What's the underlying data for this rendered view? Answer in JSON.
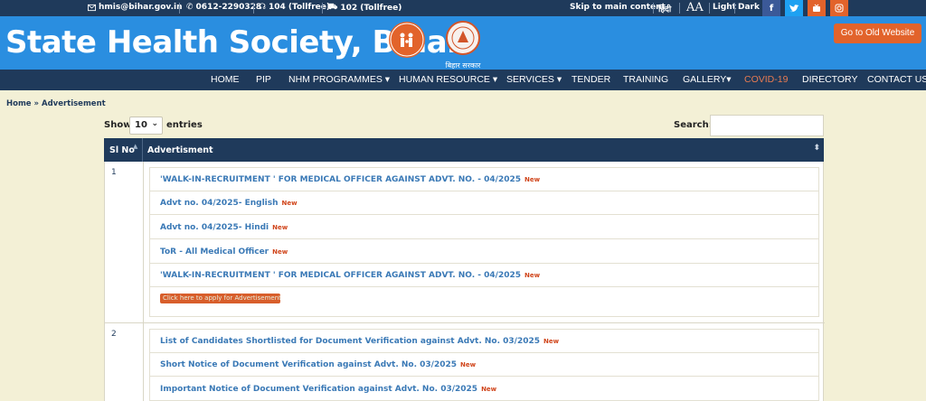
{
  "topbar": {
    "email": "hmis@bihar.gov.in",
    "phone": "0612-2290328",
    "tollfree1": "104 (Tollfree)",
    "tollfree2": "102 (Tollfree)",
    "skip": "Skip to main content",
    "hindi": "हिंदी",
    "font_size": "AA",
    "light": "Light",
    "dark": "Dark",
    "social": [
      "facebook-icon",
      "twitter-icon",
      "youtube-icon",
      "instagram-icon"
    ]
  },
  "header": {
    "title": "State Health Society, Bihar",
    "govt_caption": "बिहार सरकार",
    "old_website": "Go to Old Website"
  },
  "nav": [
    "HOME",
    "PIP",
    "NHM PROGRAMMES ▾",
    "HUMAN RESOURCE ▾",
    "SERVICES ▾",
    "TENDER",
    "TRAINING",
    "GALLERY▾",
    "COVID-19",
    "DIRECTORY",
    "CONTACT US"
  ],
  "breadcrumb": "Home » Advertisement",
  "table": {
    "show": "Show",
    "entries_value": "10",
    "entries": "entries",
    "search_label": "Search:",
    "col_slno": "Sl No",
    "col_adv": "Advertisment",
    "new_tag": "New",
    "rows": [
      {
        "slno": "1",
        "links": [
          "'WALK-IN-RECRUITMENT ' FOR MEDICAL OFFICER AGAINST ADVT. NO. - 04/2025",
          "Advt no. 04/2025- English",
          "Advt no. 04/2025- Hindi",
          "ToR - All Medical Officer",
          "'WALK-IN-RECRUITMENT ' FOR MEDICAL OFFICER AGAINST ADVT. NO. - 04/2025"
        ],
        "apply": "Click here to apply for Advertisement"
      },
      {
        "slno": "2",
        "links": [
          "List of Candidates Shortlisted for Document Verification against Advt. No. 03/2025",
          "Short Notice of Document Verification against Advt. No. 03/2025",
          "Important Notice of Document Verification against Advt. No. 03/2025"
        ]
      }
    ]
  },
  "colors": {
    "navy": "#1f3a5b",
    "blue": "#2a8ee0",
    "orange": "#e2632b",
    "link": "#3a79b6",
    "background": "#f3f0d6"
  }
}
